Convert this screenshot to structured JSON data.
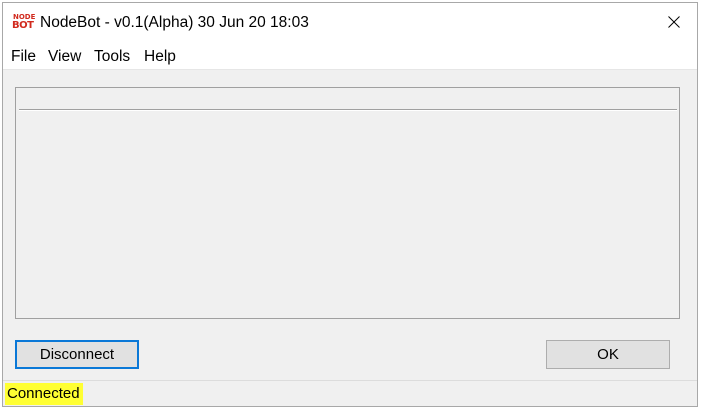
{
  "window": {
    "title": "NodeBot - v0.1(Alpha) 30 Jun 20 18:03",
    "logo_text_top": "NODE",
    "logo_text_bottom": "BOT",
    "logo_color": "#d12a1e",
    "close_icon": "close-icon"
  },
  "menu": {
    "items": [
      {
        "label": "File"
      },
      {
        "label": "View"
      },
      {
        "label": "Tools"
      },
      {
        "label": "Help"
      }
    ]
  },
  "buttons": {
    "disconnect_label": "Disconnect",
    "ok_label": "OK",
    "focus_color": "#0a78d7"
  },
  "status": {
    "text": "Connected",
    "highlight_color": "#ffff33"
  }
}
